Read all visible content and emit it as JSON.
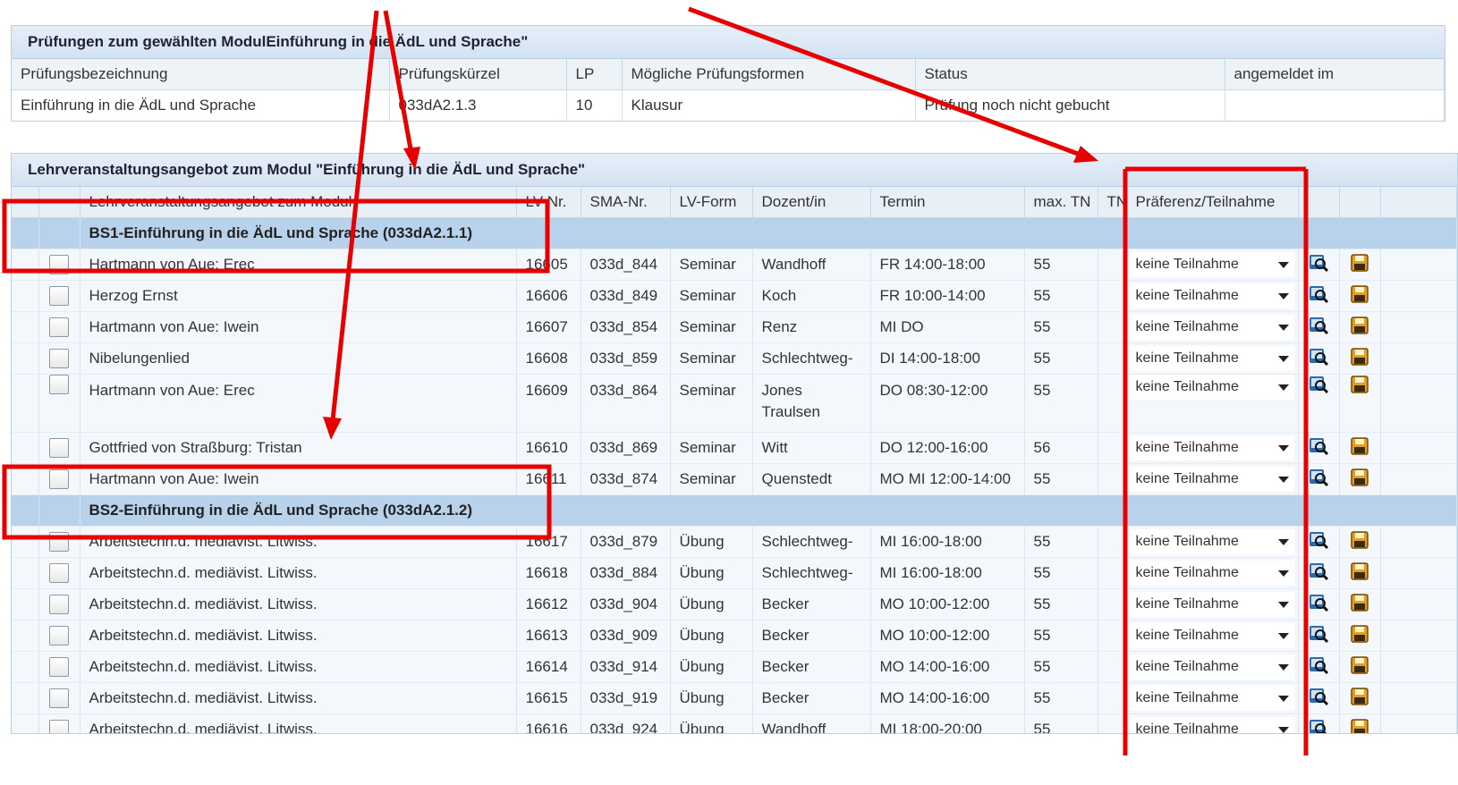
{
  "exams": {
    "title": "Prüfungen zum gewählten ModulEinführung in die ÄdL und Sprache\"",
    "columns": [
      "Prüfungsbezeichnung",
      "Prüfungskürzel",
      "LP",
      "Mögliche Prüfungsformen",
      "Status",
      "angemeldet im"
    ],
    "row": {
      "name": "Einführung in die ÄdL und Sprache",
      "code": "033dA2.1.3",
      "lp": "10",
      "form": "Klausur",
      "status": "Prüfung noch nicht gebucht",
      "registered": ""
    }
  },
  "offerings": {
    "title": "Lehrveranstaltungsangebot zum Modul \"Einführung in die ÄdL und Sprache\"",
    "columns": [
      "Lehrveranstaltungsangebot zum Modul",
      "LV-Nr.",
      "SMA-Nr.",
      "LV-Form",
      "Dozent/in",
      "Termin",
      "max. TN",
      "TN",
      "Präferenz/Teilnahme"
    ],
    "groups": [
      {
        "label": "BS1-Einführung in die ÄdL und Sprache (033dA2.1.1)",
        "rows": [
          {
            "title": "Hartmann von Aue: Erec",
            "lv": "16605",
            "sma": "033d_844",
            "form": "Seminar",
            "lecturer": "Wandhoff",
            "termin": "FR 14:00-18:00",
            "max": "55",
            "tn": "",
            "pref": "keine Teilnahme"
          },
          {
            "title": "Herzog Ernst",
            "lv": "16606",
            "sma": "033d_849",
            "form": "Seminar",
            "lecturer": "Koch",
            "termin": "FR 10:00-14:00",
            "max": "55",
            "tn": "",
            "pref": "keine Teilnahme"
          },
          {
            "title": "Hartmann von Aue: Iwein",
            "lv": "16607",
            "sma": "033d_854",
            "form": "Seminar",
            "lecturer": "Renz",
            "termin": "MI DO",
            "max": "55",
            "tn": "",
            "pref": "keine Teilnahme"
          },
          {
            "title": "Nibelungenlied",
            "lv": "16608",
            "sma": "033d_859",
            "form": "Seminar",
            "lecturer": "Schlechtweg-",
            "termin": "DI 14:00-18:00",
            "max": "55",
            "tn": "",
            "pref": "keine Teilnahme"
          },
          {
            "title": "Hartmann von Aue: Erec",
            "lv": "16609",
            "sma": "033d_864",
            "form": "Seminar",
            "lecturer": "Jones",
            "lecturer2": "Traulsen",
            "termin": "DO 08:30-12:00",
            "max": "55",
            "tn": "",
            "pref": "keine Teilnahme"
          },
          {
            "title": "Gottfried von Straßburg: Tristan",
            "lv": "16610",
            "sma": "033d_869",
            "form": "Seminar",
            "lecturer": "Witt",
            "termin": "DO 12:00-16:00",
            "max": "56",
            "tn": "",
            "pref": "keine Teilnahme"
          },
          {
            "title": "Hartmann von Aue: Iwein",
            "lv": "16611",
            "sma": "033d_874",
            "form": "Seminar",
            "lecturer": "Quenstedt",
            "termin": "MO MI 12:00-14:00",
            "max": "55",
            "tn": "",
            "pref": "keine Teilnahme"
          }
        ]
      },
      {
        "label": "BS2-Einführung in die ÄdL und Sprache (033dA2.1.2)",
        "rows": [
          {
            "title": "Arbeitstechn.d. mediävist. Litwiss.",
            "lv": "16617",
            "sma": "033d_879",
            "form": "Übung",
            "lecturer": "Schlechtweg-",
            "termin": "MI 16:00-18:00",
            "max": "55",
            "tn": "",
            "pref": "keine Teilnahme"
          },
          {
            "title": "Arbeitstechn.d. mediävist. Litwiss.",
            "lv": "16618",
            "sma": "033d_884",
            "form": "Übung",
            "lecturer": "Schlechtweg-",
            "termin": "MI 16:00-18:00",
            "max": "55",
            "tn": "",
            "pref": "keine Teilnahme"
          },
          {
            "title": "Arbeitstechn.d. mediävist. Litwiss.",
            "lv": "16612",
            "sma": "033d_904",
            "form": "Übung",
            "lecturer": "Becker",
            "termin": "MO 10:00-12:00",
            "max": "55",
            "tn": "",
            "pref": "keine Teilnahme"
          },
          {
            "title": "Arbeitstechn.d. mediävist. Litwiss.",
            "lv": "16613",
            "sma": "033d_909",
            "form": "Übung",
            "lecturer": "Becker",
            "termin": "MO 10:00-12:00",
            "max": "55",
            "tn": "",
            "pref": "keine Teilnahme"
          },
          {
            "title": "Arbeitstechn.d. mediävist. Litwiss.",
            "lv": "16614",
            "sma": "033d_914",
            "form": "Übung",
            "lecturer": "Becker",
            "termin": "MO 14:00-16:00",
            "max": "55",
            "tn": "",
            "pref": "keine Teilnahme"
          },
          {
            "title": "Arbeitstechn.d. mediävist. Litwiss.",
            "lv": "16615",
            "sma": "033d_919",
            "form": "Übung",
            "lecturer": "Becker",
            "termin": "MO 14:00-16:00",
            "max": "55",
            "tn": "",
            "pref": "keine Teilnahme"
          },
          {
            "title": "Arbeitstechn.d. mediävist. Litwiss.",
            "lv": "16616",
            "sma": "033d_924",
            "form": "Übung",
            "lecturer": "Wandhoff",
            "termin": "MI 18:00-20:00",
            "max": "55",
            "tn": "",
            "pref": "keine Teilnahme"
          }
        ]
      }
    ]
  },
  "icons": {
    "details": "magnifier-details-icon",
    "save": "save-disk-icon"
  },
  "colors": {
    "annotation": "#e60000",
    "group_row": "#b8d2eb",
    "panel_header": "#d3e2f1"
  }
}
